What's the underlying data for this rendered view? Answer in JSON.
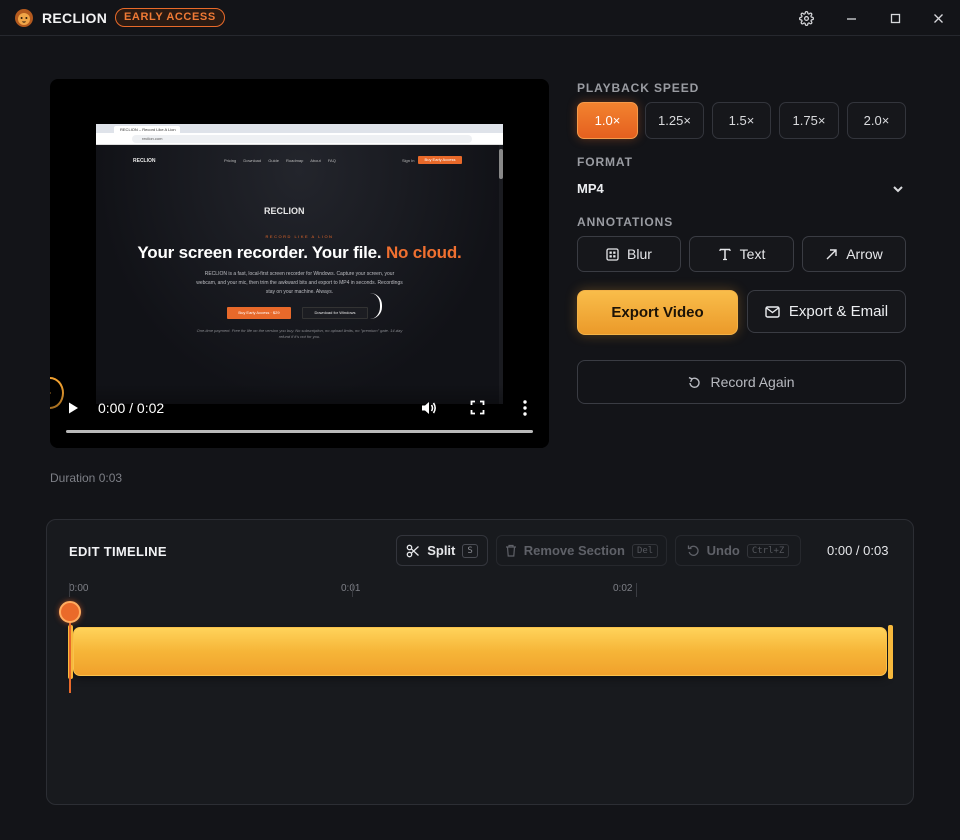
{
  "app": {
    "name": "RECLION",
    "badge": "EARLY ACCESS"
  },
  "window_controls": {
    "settings": "gear-icon",
    "minimize": "minimize-icon",
    "maximize": "maximize-icon",
    "close": "close-icon"
  },
  "video": {
    "time": "0:00 / 0:02",
    "progress": 0.0,
    "preview": {
      "tab_title": "RECLION – Record Like A Lion",
      "url": "reclion.com",
      "logo": "RECLION",
      "nav": "Pricing Download Guide Roadmap About FAQ",
      "sign_in": "Sign In",
      "nav_cta": "Buy Early Access",
      "mid_logo": "RECLION",
      "tagline": "RECORD LIKE A LION",
      "hero_main": "Your screen recorder. Your file.",
      "hero_accent": "No cloud.",
      "body": "RECLION is a fast, local-first screen recorder for Windows. Capture your screen, your webcam, and your mic, then trim the awkward bits and export to MP4 in seconds. Recordings stay on your machine. Always.",
      "btn_primary": "Buy Early Access · $29",
      "btn_secondary": "Download for Windows",
      "fine_print": "One-time payment. Free for life on the version you buy. No subscription, no upload limits, no \"premium\" gate. 14-day refund if it's not for you."
    }
  },
  "duration": "Duration 0:03",
  "playback_speed": {
    "label": "PLAYBACK SPEED",
    "options": [
      "1.0×",
      "1.25×",
      "1.5×",
      "1.75×",
      "2.0×"
    ],
    "selected": "1.0×"
  },
  "format": {
    "label": "FORMAT",
    "value": "MP4"
  },
  "annotations": {
    "label": "ANNOTATIONS",
    "blur": "Blur",
    "text": "Text",
    "arrow": "Arrow"
  },
  "actions": {
    "export": "Export Video",
    "export_email": "Export & Email",
    "record_again": "Record Again"
  },
  "timeline": {
    "title": "EDIT TIMELINE",
    "split": "Split",
    "split_key": "S",
    "remove": "Remove Section",
    "remove_key": "Del",
    "undo": "Undo",
    "undo_key": "Ctrl+Z",
    "time": "0:00 / 0:03",
    "ticks": [
      "0:00",
      "0:01",
      "0:02"
    ],
    "playhead_fraction": 0.0
  },
  "colors": {
    "accent": "#e8692a",
    "export_gold": "#f6b538",
    "background": "#131418"
  }
}
